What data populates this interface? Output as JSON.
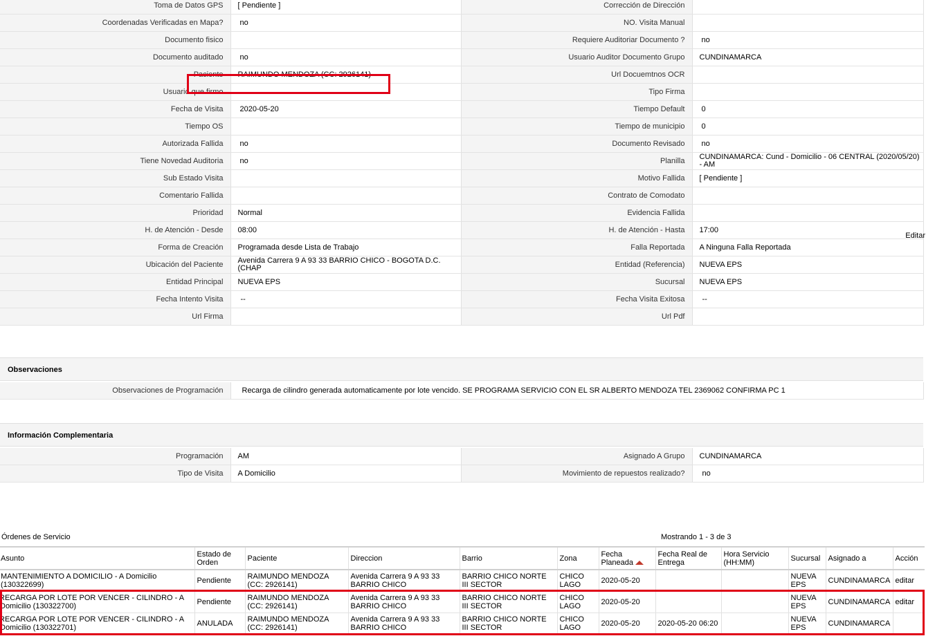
{
  "details": [
    [
      "Toma de Datos GPS",
      "[ Pendiente ]",
      "Corrección de Dirección",
      ""
    ],
    [
      "Coordenadas Verificadas en Mapa?",
      "no",
      "NO. Visita Manual",
      ""
    ],
    [
      "Documento fisico",
      "",
      "Requiere Auditoriar Documento ?",
      "no"
    ],
    [
      "Documento auditado",
      "no",
      "Usuario Auditor Documento Grupo",
      "CUNDINAMARCA"
    ],
    [
      "Paciente",
      "RAIMUNDO MENDOZA (CC: 2926141)",
      "Url Docuemtnos OCR",
      ""
    ],
    [
      "Usuario que firmo",
      "",
      "Tipo Firma",
      ""
    ],
    [
      "Fecha de Visita",
      "2020-05-20",
      "Tiempo Default",
      "0"
    ],
    [
      "Tiempo OS",
      "",
      "Tiempo de municipio",
      "0"
    ],
    [
      "Autorizada Fallida",
      "no",
      "Documento Revisado",
      "no"
    ],
    [
      "Tiene Novedad Auditoria",
      "no",
      "Planilla",
      "CUNDINAMARCA: Cund - Domicilio - 06 CENTRAL (2020/05/20) - AM"
    ],
    [
      "Sub Estado Visita",
      "",
      "Motivo Fallida",
      "[ Pendiente ]"
    ],
    [
      "Comentario Fallida",
      "",
      "Contrato de Comodato",
      ""
    ],
    [
      "Prioridad",
      "Normal",
      "Evidencia Fallida",
      ""
    ],
    [
      "H. de Atención - Desde",
      "08:00",
      "H. de Atención - Hasta",
      "17:00"
    ],
    [
      "Forma de Creación",
      "Programada desde Lista de Trabajo",
      "Falla Reportada",
      "A Ninguna Falla Reportada"
    ],
    [
      "Ubicación del Paciente",
      "Avenida Carrera 9 A 93 33 BARRIO CHICO - BOGOTA D.C. (CHAP",
      "Entidad (Referencia)",
      "NUEVA EPS"
    ],
    [
      "Entidad Principal",
      "NUEVA EPS",
      "Sucursal",
      "NUEVA EPS"
    ],
    [
      "Fecha Intento Visita",
      "--",
      "Fecha Visita Exitosa",
      "--"
    ],
    [
      "Url Firma",
      "",
      "Url Pdf",
      ""
    ]
  ],
  "edit_label": "Editar",
  "observaciones": {
    "title": "Observaciones",
    "label": "Observaciones de Programación",
    "value": "Recarga de cilindro generada automaticamente por lote vencido. SE PROGRAMA SERVICIO CON EL SR ALBERTO MENDOZA TEL 2369062 CONFIRMA PC 1"
  },
  "complementaria": {
    "title": "Información Complementaria",
    "rows": [
      [
        "Programación",
        "AM",
        "Asignado A Grupo",
        "CUNDINAMARCA"
      ],
      [
        "Tipo de Visita",
        "A Domicilio",
        "Movimiento de repuestos realizado?",
        "no"
      ]
    ]
  },
  "orders": {
    "title": "Órdenes de Servicio",
    "count": "Mostrando 1 - 3 de 3",
    "columns": [
      "Asunto",
      "Estado de Orden",
      "Paciente",
      "Direccion",
      "Barrio",
      "Zona",
      "Fecha Planeada",
      "Fecha Real de Entrega",
      "Hora Servicio (HH:MM)",
      "Sucursal",
      "Asignado a",
      "Acción"
    ],
    "rows": [
      [
        "MANTENIMIENTO A DOMICILIO - A Domicilio (130322699)",
        "Pendiente",
        "RAIMUNDO MENDOZA (CC: 2926141)",
        "Avenida Carrera 9 A 93 33 BARRIO CHICO",
        "BARRIO CHICO NORTE III SECTOR",
        "CHICO LAGO",
        "2020-05-20",
        "",
        "",
        "NUEVA EPS",
        "CUNDINAMARCA",
        "editar"
      ],
      [
        "RECARGA POR LOTE POR VENCER - CILINDRO - A Domicilio (130322700)",
        "Pendiente",
        "RAIMUNDO MENDOZA (CC: 2926141)",
        "Avenida Carrera 9 A 93 33 BARRIO CHICO",
        "BARRIO CHICO NORTE III SECTOR",
        "CHICO LAGO",
        "2020-05-20",
        "",
        "",
        "NUEVA EPS",
        "CUNDINAMARCA",
        "editar"
      ],
      [
        "RECARGA POR LOTE POR VENCER - CILINDRO - A Domicilio (130322701)",
        "ANULADA",
        "RAIMUNDO MENDOZA (CC: 2926141)",
        "Avenida Carrera 9 A 93 33 BARRIO CHICO",
        "BARRIO CHICO NORTE III SECTOR",
        "CHICO LAGO",
        "2020-05-20",
        "2020-05-20 06:20",
        "",
        "NUEVA EPS",
        "CUNDINAMARCA",
        ""
      ]
    ]
  },
  "colors": {
    "highlight": "#e00016",
    "label_bg": "#f4f4f4",
    "sort_arrow": "#c0392b"
  }
}
